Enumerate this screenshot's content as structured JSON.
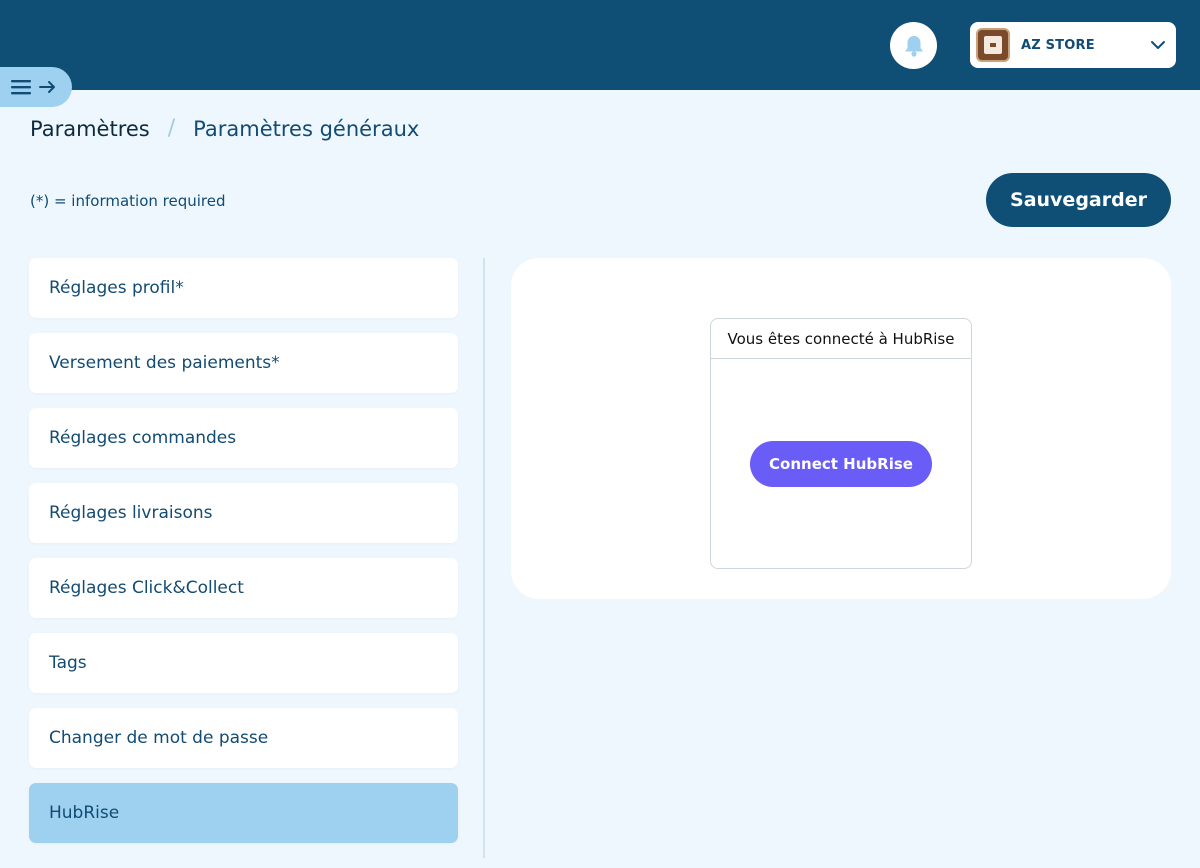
{
  "header": {
    "store_name": "AZ STORE",
    "icons": {
      "notifications": "bell-icon",
      "dropdown": "chevron-down-icon",
      "menu": "menu-icon",
      "expand": "arrow-right-icon"
    }
  },
  "breadcrumb": {
    "root": "Paramètres",
    "separator": "/",
    "current": "Paramètres généraux"
  },
  "required_note": "(*) = information required",
  "save_label": "Sauvegarder",
  "nav": {
    "items": [
      {
        "label": "Réglages profil*"
      },
      {
        "label": "Versement des paiements*"
      },
      {
        "label": "Réglages commandes"
      },
      {
        "label": "Réglages livraisons"
      },
      {
        "label": "Réglages Click&Collect"
      },
      {
        "label": "Tags"
      },
      {
        "label": "Changer de mot de passe"
      },
      {
        "label": "HubRise"
      }
    ],
    "active": "HubRise"
  },
  "hubrise": {
    "card_title": "Vous êtes connecté à HubRise",
    "connect_label": "Connect HubRise"
  },
  "colors": {
    "topbar": "#0f4f75",
    "page_bg": "#eef7fd",
    "active_nav": "#9dd1ef",
    "connect_button": "#6a5cf6",
    "text": "#124b73"
  }
}
